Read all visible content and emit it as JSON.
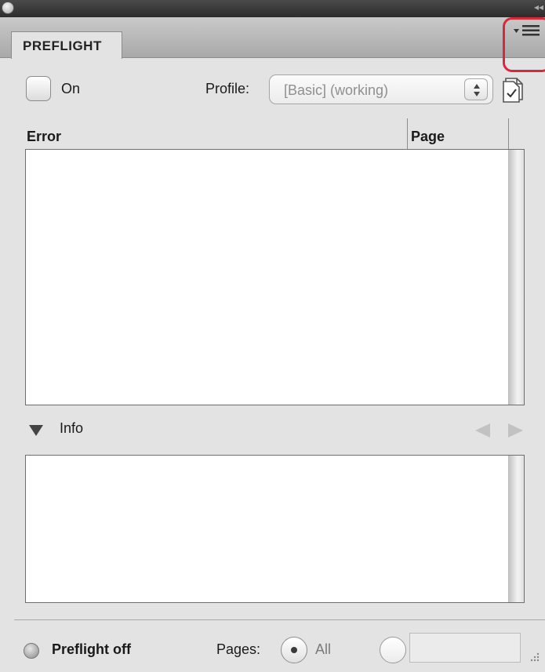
{
  "panel": {
    "tab_label": "PREFLIGHT",
    "menu_icon": "panel-menu-icon",
    "highlight_color": "#d8283c"
  },
  "controls": {
    "on_label": "On",
    "on_checked": false,
    "profile_label": "Profile:",
    "profile_value": "[Basic] (working)"
  },
  "error_list": {
    "columns": [
      "Error",
      "Page"
    ],
    "rows": []
  },
  "info": {
    "label": "Info",
    "expanded": true
  },
  "footer": {
    "status_label": "Preflight off",
    "pages_label": "Pages:",
    "all_label": "All",
    "all_selected": true,
    "range_value": ""
  }
}
